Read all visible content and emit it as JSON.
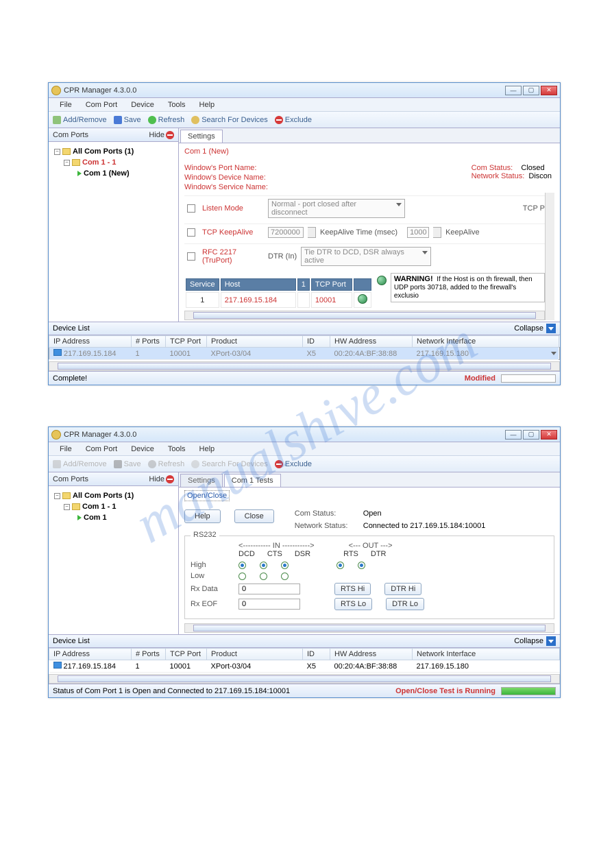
{
  "watermark": "manualshive.com",
  "win1": {
    "title": "CPR Manager 4.3.0.0",
    "menu": [
      "File",
      "Com Port",
      "Device",
      "Tools",
      "Help"
    ],
    "toolbar": {
      "addremove": "Add/Remove",
      "save": "Save",
      "refresh": "Refresh",
      "search": "Search For Devices",
      "exclude": "Exclude"
    },
    "left": {
      "hdr": "Com Ports",
      "hide": "Hide",
      "root": "All Com Ports (1)",
      "child": "Com 1 - 1",
      "leaf": "Com 1 (New)"
    },
    "tab": "Settings",
    "hdrline": "Com 1 (New)",
    "labels": {
      "wpname": "Window's Port Name:",
      "wdname": "Window's Device Name:",
      "wsname": "Window's Service Name:",
      "comstatus": "Com Status:",
      "netstatus": "Network Status:",
      "comv": "Closed",
      "netv": "Discon"
    },
    "listen": {
      "lbl": "Listen Mode",
      "sel": "Normal - port closed after disconnect",
      "tcp": "TCP P"
    },
    "keep": {
      "lbl": "TCP KeepAlive",
      "val": "7200000",
      "time": "KeepAlive Time (msec)",
      "val2": "1000",
      "al": "KeepAlive"
    },
    "rfc": {
      "lbl": "RFC 2217",
      "sub": "(TruPort)",
      "dtr": "DTR (In)",
      "sel": "Tie DTR to DCD, DSR always active"
    },
    "svc": {
      "h1": "Service",
      "h2": "Host",
      "h3": "1",
      "h4": "TCP Port",
      "r1": "1",
      "r2": "217.169.15.184",
      "r3": "",
      "r4": "10001"
    },
    "warn": "WARNING!  If the Host is on th firewall, then UDP ports 30718, added to the firewall's exclusio",
    "devlist": {
      "hdr": "Device List",
      "collapse": "Collapse",
      "cols": [
        "IP Address",
        "# Ports",
        "TCP Port",
        "Product",
        "ID",
        "HW Address",
        "Network Interface"
      ],
      "row": [
        "217.169.15.184",
        "1",
        "10001",
        "XPort-03/04",
        "X5",
        "00:20:4A:BF:38:88",
        "217.169.15.180"
      ]
    },
    "status": {
      "l": "Complete!",
      "r": "Modified"
    }
  },
  "win2": {
    "title": "CPR Manager 4.3.0.0",
    "menu": [
      "File",
      "Com Port",
      "Device",
      "Tools",
      "Help"
    ],
    "toolbar": {
      "addremove": "Add/Remove",
      "save": "Save",
      "refresh": "Refresh",
      "search": "Search For Devices",
      "exclude": "Exclude"
    },
    "left": {
      "hdr": "Com Ports",
      "hide": "Hide",
      "root": "All Com Ports (1)",
      "child": "Com 1 - 1",
      "leaf": "Com 1"
    },
    "tabs": [
      "Settings",
      "Com 1 Tests"
    ],
    "oc": "Open/Close",
    "help": "Help",
    "close": "Close",
    "cs": {
      "l": "Com Status:",
      "v": "Open"
    },
    "ns": {
      "l": "Network Status:",
      "v": "Connected to 217.169.15.184:10001"
    },
    "rs232": "RS232",
    "inlbl": "<----------- IN ----------->",
    "outlbl": "<--- OUT --->",
    "cols": [
      "DCD",
      "CTS",
      "DSR",
      "RTS",
      "DTR"
    ],
    "high": "High",
    "low": "Low",
    "rxdata": "Rx Data",
    "rxeof": "Rx EOF",
    "zero": "0",
    "btns": {
      "rtshi": "RTS Hi",
      "dtrhi": "DTR Hi",
      "rtslo": "RTS Lo",
      "dtrlo": "DTR Lo"
    },
    "devlist": {
      "hdr": "Device List",
      "collapse": "Collapse",
      "cols": [
        "IP Address",
        "# Ports",
        "TCP Port",
        "Product",
        "ID",
        "HW Address",
        "Network Interface"
      ],
      "row": [
        "217.169.15.184",
        "1",
        "10001",
        "XPort-03/04",
        "X5",
        "00:20:4A:BF:38:88",
        "217.169.15.180"
      ]
    },
    "status": {
      "l": "Status of Com Port 1 is Open and Connected to 217.169.15.184:10001",
      "r": "Open/Close Test is Running"
    }
  }
}
